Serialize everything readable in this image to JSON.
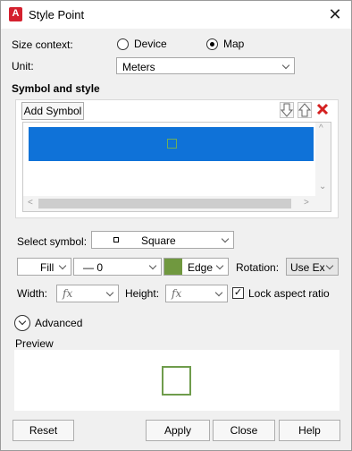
{
  "window": {
    "title": "Style Point",
    "app_icon_letter": "A"
  },
  "size_context": {
    "label": "Size context:",
    "options": [
      "Device",
      "Map"
    ],
    "selected": "Map"
  },
  "unit": {
    "label": "Unit:",
    "value": "Meters"
  },
  "symbol_and_style": {
    "title": "Symbol and style",
    "add_symbol_label": "Add Symbol"
  },
  "select_symbol": {
    "label": "Select symbol:",
    "value": "Square"
  },
  "fill": {
    "label": "Fill"
  },
  "line": {
    "value": "— 0"
  },
  "edge": {
    "label": "Edge",
    "color": "#70983f"
  },
  "rotation": {
    "label": "Rotation:",
    "value": "Use Ex"
  },
  "width": {
    "label": "Width:",
    "value": "fx"
  },
  "height": {
    "label": "Height:",
    "value": "fx"
  },
  "lock_aspect": {
    "label": "Lock aspect ratio",
    "checked": true,
    "mark": "✓"
  },
  "advanced": {
    "label": "Advanced"
  },
  "preview": {
    "label": "Preview"
  },
  "buttons": {
    "reset": "Reset",
    "apply": "Apply",
    "close": "Close",
    "help": "Help"
  },
  "colors": {
    "selection": "#0f72d8",
    "symbol_green": "#70983f",
    "delete_red": "#d42020"
  }
}
